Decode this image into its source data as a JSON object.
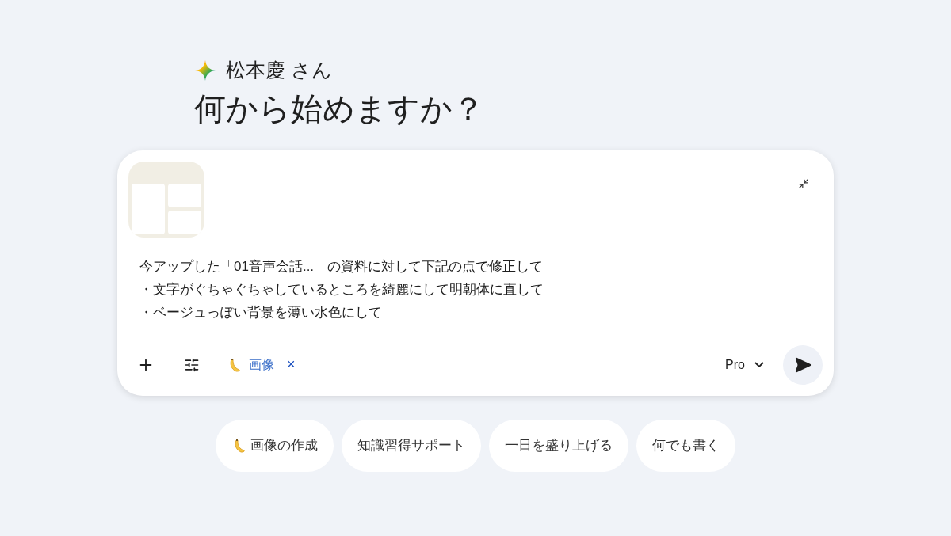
{
  "greeting": {
    "name": "松本慶 さん",
    "title": "何から始めますか？"
  },
  "composer": {
    "attachment": {
      "kind": "image"
    },
    "lines": [
      "今アップした「01音声会話...」の資料に対して下記の点で修正して",
      "・文字がぐちゃぐちゃしているところを綺麗にして明朝体に直して",
      "・ベージュっぽい背景を薄い水色にして"
    ],
    "tool_chip": {
      "label": "画像",
      "close": "×"
    },
    "model": "Pro"
  },
  "suggestions": [
    {
      "label": "画像の作成",
      "banana": true
    },
    {
      "label": "知識習得サポート",
      "banana": false
    },
    {
      "label": "一日を盛り上げる",
      "banana": false
    },
    {
      "label": "何でも書く",
      "banana": false
    }
  ]
}
